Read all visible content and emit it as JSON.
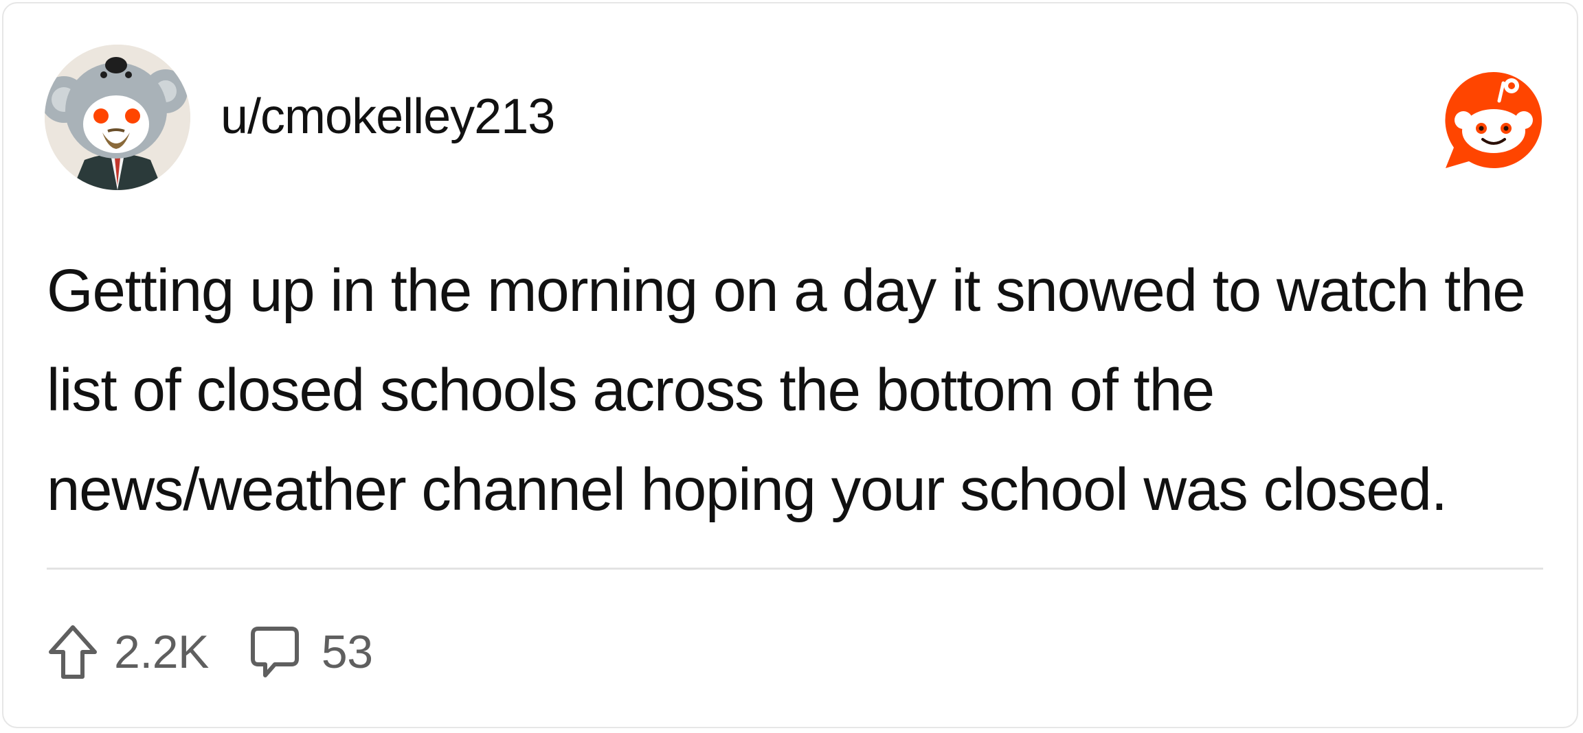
{
  "post": {
    "username": "u/cmokelley213",
    "avatar_icon": "koala-snoo-avatar",
    "logo_icon": "reddit-logo-icon",
    "body": "Getting up in the morning on a day it snowed to watch the list of closed schools across the bottom of the news/weather channel hoping your school was closed."
  },
  "stats": {
    "upvotes": "2.2K",
    "comments": "53",
    "upvote_icon": "upvote-arrow-icon",
    "comment_icon": "comment-bubble-icon"
  },
  "colors": {
    "reddit_orange": "#ff4500",
    "text": "#111111",
    "muted": "#5f5f5f",
    "divider": "#e3e3e3"
  }
}
